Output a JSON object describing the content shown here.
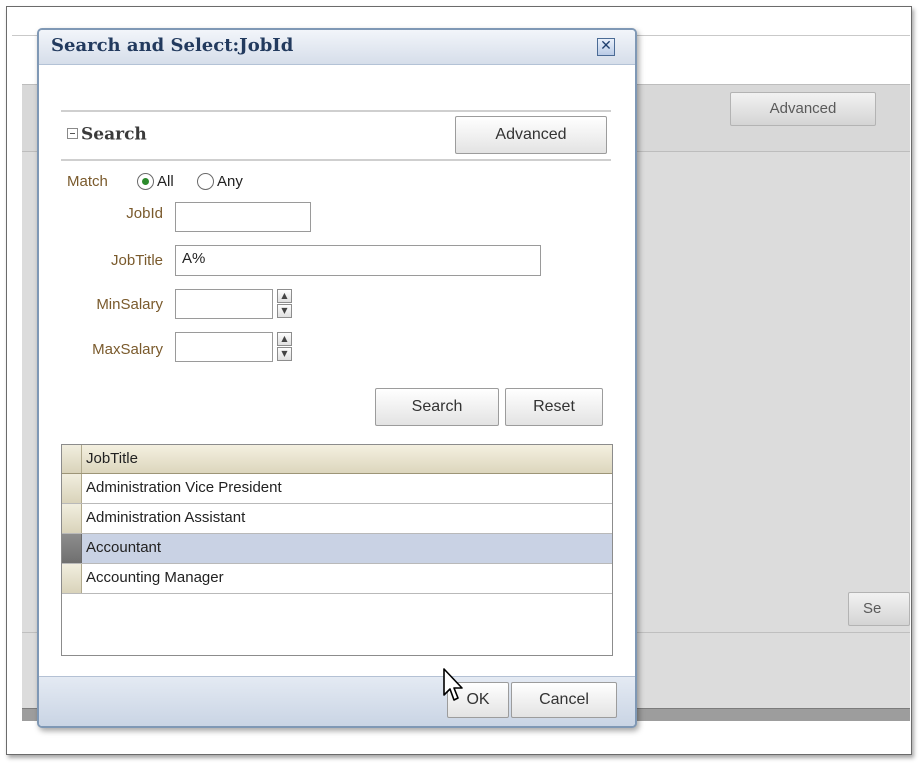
{
  "background": {
    "advanced_label": "Advanced",
    "partial_search_label": "Se"
  },
  "dialog": {
    "title": "Search and Select:JobId",
    "close_icon": "close-icon"
  },
  "search": {
    "header": "Search",
    "advanced_label": "Advanced",
    "match": {
      "label": "Match",
      "options": [
        "All",
        "Any"
      ],
      "selected": "All"
    },
    "fields": {
      "jobid": {
        "label": "JobId",
        "value": ""
      },
      "jobtitle": {
        "label": "JobTitle",
        "value": "A%"
      },
      "minsalary": {
        "label": "MinSalary",
        "value": ""
      },
      "maxsalary": {
        "label": "MaxSalary",
        "value": ""
      }
    },
    "search_button": "Search",
    "reset_button": "Reset"
  },
  "results": {
    "column_header": "JobTitle",
    "rows": [
      "Administration Vice President",
      "Administration Assistant",
      "Accountant",
      "Accounting Manager"
    ],
    "selected_index": 2
  },
  "footer": {
    "ok_label": "OK",
    "cancel_label": "Cancel"
  },
  "colors": {
    "title_text": "#223a5e",
    "label_text": "#7a5a2c",
    "selected_row": "#c9d2e4"
  }
}
